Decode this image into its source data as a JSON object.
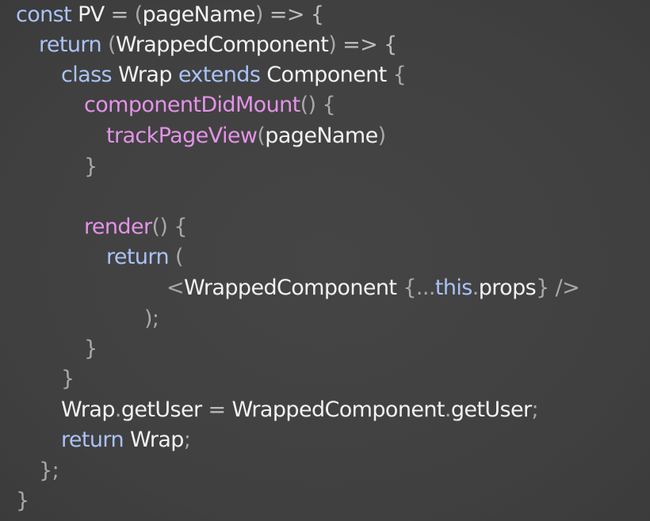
{
  "editor": {
    "background": "#414141",
    "colors": {
      "keyword": "#a9c3f7",
      "function": "#e493e8",
      "identifier": "#f2f2f2",
      "punctuation": "#a8a8a8"
    },
    "lines": [
      {
        "tokens": [
          {
            "t": "const",
            "k": "kw"
          },
          {
            "t": " PV ",
            "k": "id"
          },
          {
            "t": "=",
            "k": "op"
          },
          {
            "t": " (",
            "k": "pn"
          },
          {
            "t": "pageName",
            "k": "id"
          },
          {
            "t": ")",
            "k": "pn"
          },
          {
            "t": " => {",
            "k": "op"
          }
        ]
      },
      {
        "tokens": [
          {
            "t": "return",
            "k": "kw"
          },
          {
            "t": " (",
            "k": "pn"
          },
          {
            "t": "WrappedComponent",
            "k": "id"
          },
          {
            "t": ")",
            "k": "pn"
          },
          {
            "t": " => {",
            "k": "op"
          }
        ]
      },
      {
        "tokens": [
          {
            "t": "class",
            "k": "kw"
          },
          {
            "t": " Wrap ",
            "k": "id"
          },
          {
            "t": "extends",
            "k": "kw"
          },
          {
            "t": " Component ",
            "k": "id"
          },
          {
            "t": "{",
            "k": "pn"
          }
        ]
      },
      {
        "tokens": [
          {
            "t": "componentDidMount",
            "k": "fn"
          },
          {
            "t": "() {",
            "k": "pn"
          }
        ]
      },
      {
        "tokens": [
          {
            "t": "trackPageView",
            "k": "fn"
          },
          {
            "t": "(",
            "k": "pn"
          },
          {
            "t": "pageName",
            "k": "id"
          },
          {
            "t": ")",
            "k": "pn"
          }
        ]
      },
      {
        "tokens": [
          {
            "t": "}",
            "k": "pn"
          }
        ]
      },
      {
        "tokens": []
      },
      {
        "tokens": [
          {
            "t": "render",
            "k": "fn"
          },
          {
            "t": "() {",
            "k": "pn"
          }
        ]
      },
      {
        "tokens": [
          {
            "t": "return",
            "k": "kw"
          },
          {
            "t": " (",
            "k": "pn"
          }
        ]
      },
      {
        "tokens": [
          {
            "t": "<",
            "k": "pn"
          },
          {
            "t": "WrappedComponent ",
            "k": "id"
          },
          {
            "t": "{...",
            "k": "pn"
          },
          {
            "t": "this",
            "k": "kw"
          },
          {
            "t": ".",
            "k": "pn"
          },
          {
            "t": "props",
            "k": "id"
          },
          {
            "t": "} />",
            "k": "pn"
          }
        ]
      },
      {
        "tokens": [
          {
            "t": ");",
            "k": "pn"
          }
        ]
      },
      {
        "tokens": [
          {
            "t": "}",
            "k": "pn"
          }
        ]
      },
      {
        "tokens": [
          {
            "t": "}",
            "k": "pn"
          }
        ]
      },
      {
        "tokens": [
          {
            "t": "Wrap",
            "k": "id"
          },
          {
            "t": ".",
            "k": "pn"
          },
          {
            "t": "getUser ",
            "k": "id"
          },
          {
            "t": "=",
            "k": "op"
          },
          {
            "t": " WrappedComponent",
            "k": "id"
          },
          {
            "t": ".",
            "k": "pn"
          },
          {
            "t": "getUser",
            "k": "id"
          },
          {
            "t": ";",
            "k": "pn"
          }
        ]
      },
      {
        "tokens": [
          {
            "t": "return",
            "k": "kw"
          },
          {
            "t": " Wrap",
            "k": "id"
          },
          {
            "t": ";",
            "k": "pn"
          }
        ]
      },
      {
        "tokens": [
          {
            "t": "};",
            "k": "pn"
          }
        ]
      },
      {
        "tokens": [
          {
            "t": "}",
            "k": "pn"
          }
        ]
      }
    ]
  }
}
